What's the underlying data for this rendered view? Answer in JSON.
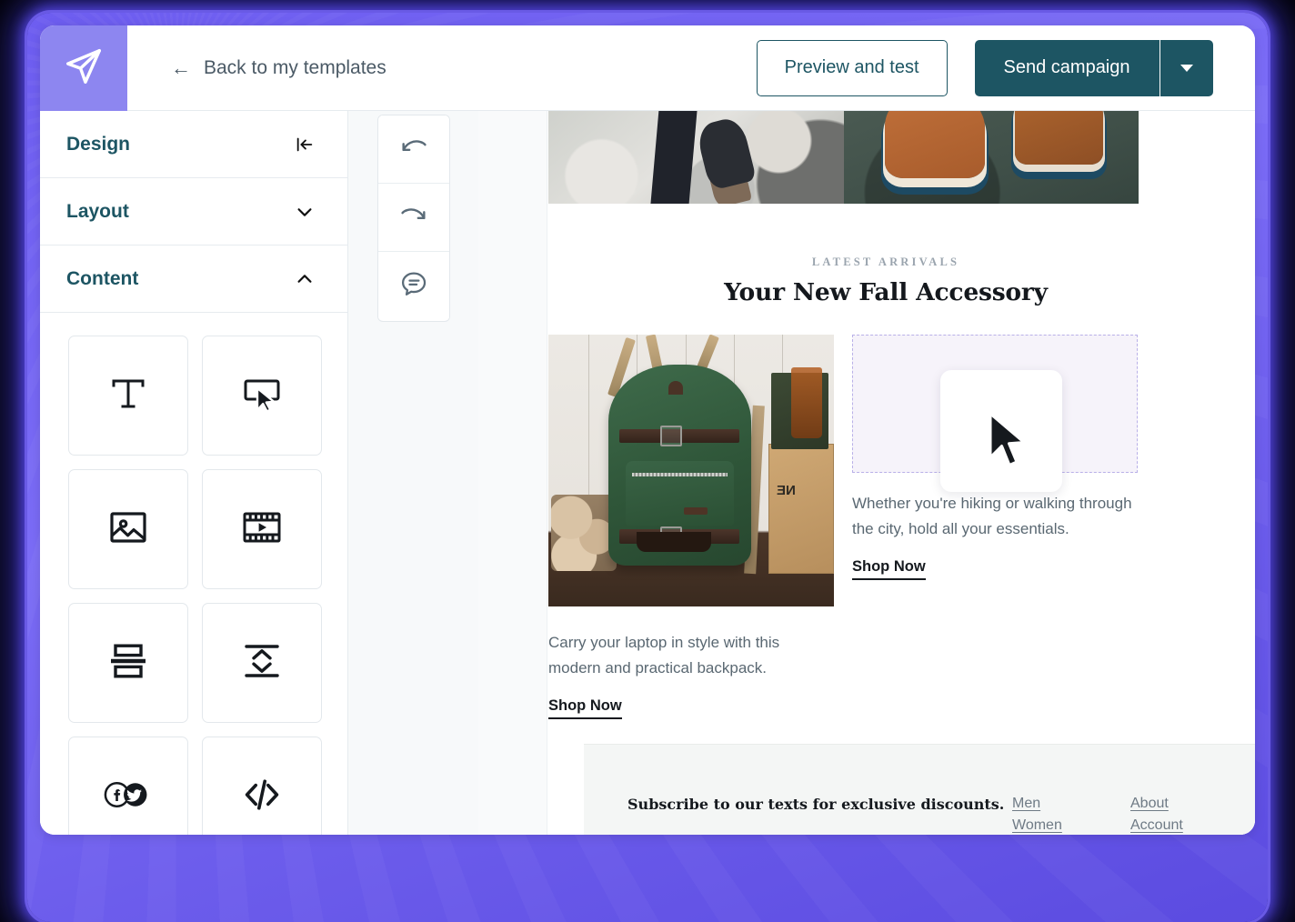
{
  "app": {
    "brand_icon": "paper-plane-icon",
    "brand_color": "#8d86f0",
    "accent_teal": "#1d5563"
  },
  "topbar": {
    "back_label": "Back to my templates",
    "back_icon": "arrow-left-icon",
    "preview_label": "Preview and test",
    "send_label": "Send campaign",
    "send_dropdown_icon": "chevron-down-icon"
  },
  "sidebar": {
    "panels": [
      {
        "label": "Design",
        "icon": "collapse-panel-icon",
        "state": "collapse"
      },
      {
        "label": "Layout",
        "icon": "chevron-down-icon",
        "state": "collapsed"
      },
      {
        "label": "Content",
        "icon": "chevron-up-icon",
        "state": "expanded"
      }
    ],
    "blocks": [
      {
        "name": "text-block",
        "icon": "text-t-icon"
      },
      {
        "name": "button-block",
        "icon": "button-cursor-icon"
      },
      {
        "name": "image-block",
        "icon": "picture-icon"
      },
      {
        "name": "video-block",
        "icon": "film-play-icon"
      },
      {
        "name": "divider-block",
        "icon": "split-rows-icon"
      },
      {
        "name": "spacer-block",
        "icon": "spacer-arrows-icon"
      },
      {
        "name": "social-block",
        "icon": "social-facebook-twitter-icon"
      },
      {
        "name": "html-block",
        "icon": "code-brackets-icon"
      }
    ]
  },
  "toolrail": {
    "buttons": [
      {
        "name": "undo-button",
        "icon": "undo-arrow-icon"
      },
      {
        "name": "redo-button",
        "icon": "redo-arrow-icon"
      },
      {
        "name": "comment-button",
        "icon": "comment-bubble-icon"
      }
    ]
  },
  "email": {
    "hero": {
      "left_alt": "hiker-boots-on-rocks",
      "right_alt": "leather-boots-on-pavement"
    },
    "eyebrow": "LATEST ARRIVALS",
    "headline": "Your New Fall Accessory",
    "left_column": {
      "image_alt": "green-canvas-backpack",
      "crate_text": "NE",
      "body": "Carry your laptop in style with this modern and practical backpack.",
      "cta": "Shop Now"
    },
    "right_column": {
      "dropzone_state": "empty-image-placeholder",
      "drag_icon": "picture-icon",
      "cursor_icon": "mouse-pointer-icon",
      "body": "Whether you're hiking or walking through the city, hold all your essentials.",
      "cta": "Shop Now"
    },
    "footer": {
      "headline": "Subscribe to our texts for exclusive discounts.",
      "columns": [
        {
          "links": [
            "Men",
            "Women"
          ]
        },
        {
          "links": [
            "About",
            "Account"
          ]
        }
      ]
    }
  }
}
